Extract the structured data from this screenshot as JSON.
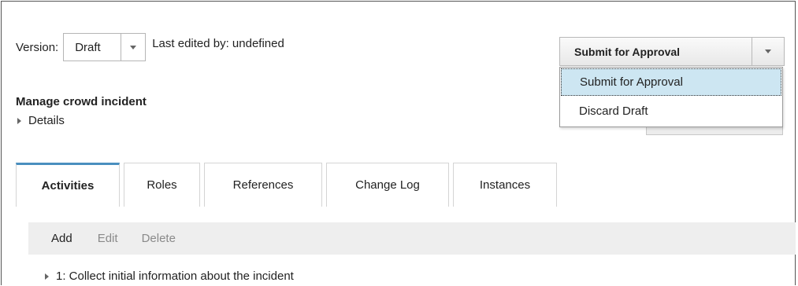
{
  "version": {
    "label": "Version:",
    "selected": "Draft",
    "last_edited": "Last edited by: undefined"
  },
  "submit_button": {
    "label": "Submit for Approval"
  },
  "dropdown_menu": {
    "items": [
      {
        "label": "Submit for Approval",
        "active": true
      },
      {
        "label": "Discard Draft",
        "active": false
      }
    ]
  },
  "process": {
    "title": "Manage crowd incident",
    "details_label": "Details"
  },
  "tabs": [
    {
      "label": "Activities",
      "active": true
    },
    {
      "label": "Roles",
      "active": false
    },
    {
      "label": "References",
      "active": false
    },
    {
      "label": "Change Log",
      "active": false
    },
    {
      "label": "Instances",
      "active": false
    }
  ],
  "toolbar": {
    "add": "Add",
    "edit": "Edit",
    "delete": "Delete"
  },
  "activities": [
    {
      "label": "1: Collect initial information about the incident"
    }
  ],
  "colors": {
    "active_tab_accent": "#4a8fbf",
    "menu_highlight": "#cde6f2",
    "toolbar_bg": "#eeeeee",
    "disabled_text": "#8a8a8a"
  }
}
